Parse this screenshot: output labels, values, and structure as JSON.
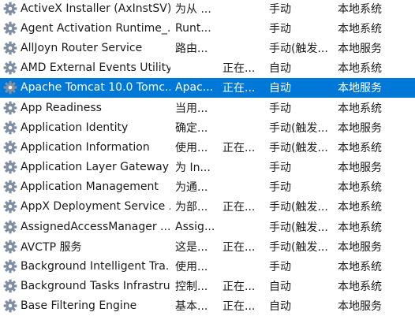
{
  "services": [
    {
      "name": "ActiveX Installer (AxInstSV)",
      "description": "为从 ...",
      "status": "",
      "startup": "手动",
      "logon": "本地系统"
    },
    {
      "name": "Agent Activation Runtime_...",
      "description": "Runt...",
      "status": "",
      "startup": "手动",
      "logon": "本地系统"
    },
    {
      "name": "AllJoyn Router Service",
      "description": "路由...",
      "status": "",
      "startup": "手动(触发...",
      "logon": "本地服务"
    },
    {
      "name": "AMD External Events Utility",
      "description": "",
      "status": "正在...",
      "startup": "自动",
      "logon": "本地系统"
    },
    {
      "name": "Apache Tomcat 10.0 Tomc...",
      "description": "Apac...",
      "status": "正在...",
      "startup": "自动",
      "logon": "本地服务",
      "selected": true
    },
    {
      "name": "App Readiness",
      "description": "当用...",
      "status": "",
      "startup": "手动",
      "logon": "本地系统"
    },
    {
      "name": "Application Identity",
      "description": "确定...",
      "status": "",
      "startup": "手动(触发...",
      "logon": "本地服务"
    },
    {
      "name": "Application Information",
      "description": "使用...",
      "status": "正在...",
      "startup": "手动(触发...",
      "logon": "本地系统"
    },
    {
      "name": "Application Layer Gateway ...",
      "description": "为 In...",
      "status": "",
      "startup": "手动",
      "logon": "本地服务"
    },
    {
      "name": "Application Management",
      "description": "为通...",
      "status": "",
      "startup": "手动",
      "logon": "本地系统"
    },
    {
      "name": "AppX Deployment Service ...",
      "description": "为部...",
      "status": "正在...",
      "startup": "手动(触发...",
      "logon": "本地系统"
    },
    {
      "name": "AssignedAccessManager ...",
      "description": "Assig...",
      "status": "",
      "startup": "手动(触发...",
      "logon": "本地系统"
    },
    {
      "name": "AVCTP 服务",
      "description": "这是...",
      "status": "正在...",
      "startup": "手动(触发...",
      "logon": "本地服务"
    },
    {
      "name": "Background Intelligent Tra...",
      "description": "使用...",
      "status": "",
      "startup": "手动",
      "logon": "本地系统"
    },
    {
      "name": "Background Tasks Infrastru...",
      "description": "控制...",
      "status": "正在...",
      "startup": "自动",
      "logon": "本地系统"
    },
    {
      "name": "Base Filtering Engine",
      "description": "基本...",
      "status": "正在...",
      "startup": "自动",
      "logon": "本地服务"
    }
  ],
  "colors": {
    "selection": "#0078d7",
    "gear": "#7f8fa3"
  }
}
